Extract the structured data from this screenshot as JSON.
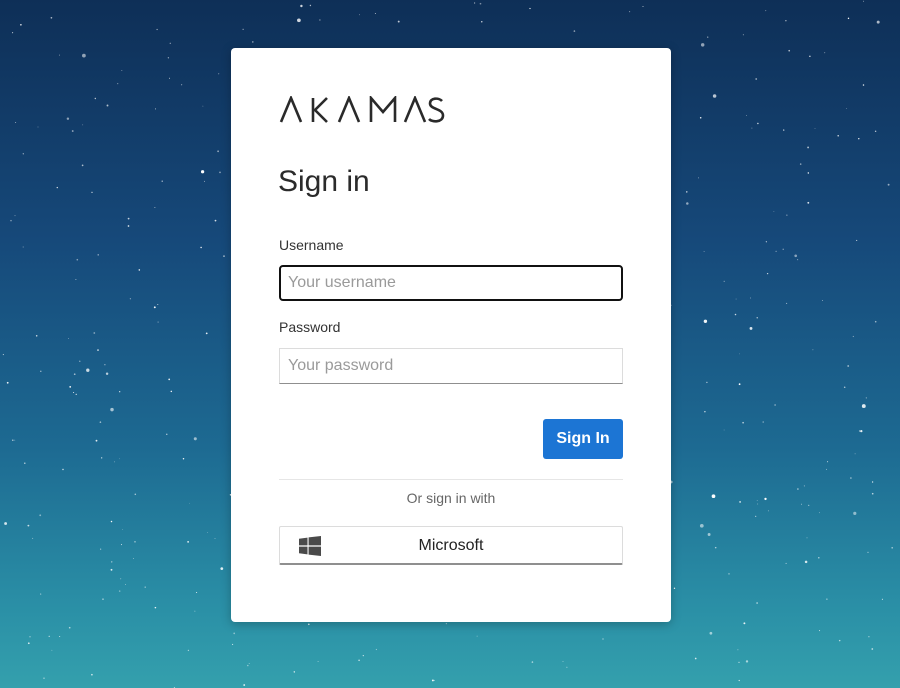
{
  "brand": {
    "logo_text": "AKAMAS"
  },
  "login": {
    "title": "Sign in",
    "username_label": "Username",
    "username_placeholder": "Your username",
    "username_value": "",
    "password_label": "Password",
    "password_placeholder": "Your password",
    "password_value": "",
    "signin_button": "Sign In",
    "alt_text": "Or sign in with",
    "microsoft_button": "Microsoft"
  },
  "icons": {
    "microsoft": "windows-logo-icon"
  },
  "colors": {
    "primary": "#1c75d4",
    "background_top": "#0e2f57",
    "background_bottom": "#34a0ad",
    "card": "#ffffff"
  }
}
